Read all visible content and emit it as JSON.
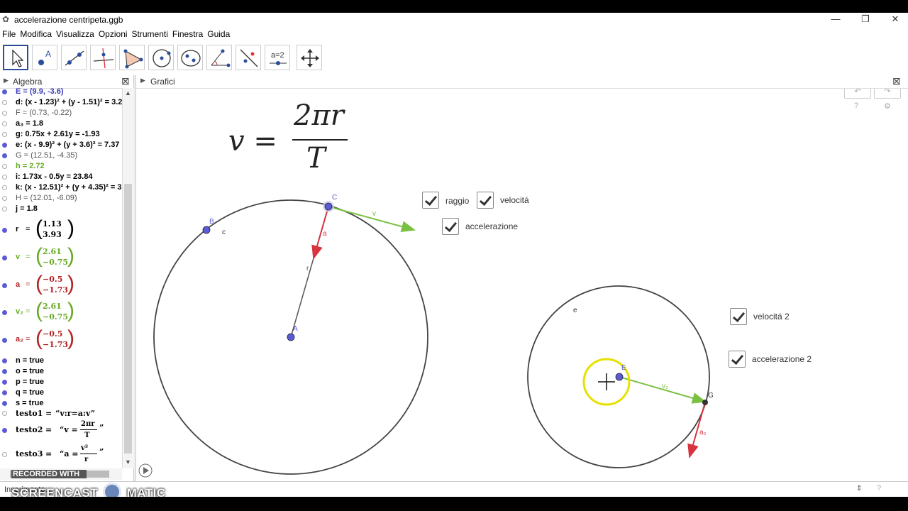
{
  "window": {
    "title": "accelerazione centripeta.ggb"
  },
  "menu": [
    "File",
    "Modifica",
    "Visualizza",
    "Opzioni",
    "Strumenti",
    "Finestra",
    "Guida"
  ],
  "tools": [
    "move-tool",
    "point-tool",
    "line-tool",
    "perpendicular-tool",
    "polygon-tool",
    "circle-tool",
    "conic-tool",
    "angle-tool",
    "reflect-tool",
    "slider-tool",
    "move-view-tool"
  ],
  "slider_tool_label": "a=2",
  "panels": {
    "algebra": "Algebra",
    "graphics": "Grafici"
  },
  "algebra": {
    "rows": [
      {
        "label": "E = (9.9, -3.6)",
        "color": "blue",
        "visible": true
      },
      {
        "label": "d: (x - 1.23)² + (y - 1.51)² = 3.2",
        "color": "black",
        "visible": false
      },
      {
        "label": "F = (0.73, -0.22)",
        "color": "gray",
        "visible": false
      },
      {
        "label": "a₃ = 1.8",
        "color": "black",
        "visible": false
      },
      {
        "label": "g: 0.75x + 2.61y = -1.93",
        "color": "black",
        "visible": false
      },
      {
        "label": "e: (x - 9.9)² + (y + 3.6)² = 7.37",
        "color": "black",
        "visible": true
      },
      {
        "label": "G = (12.51, -4.35)",
        "color": "gray",
        "visible": true
      },
      {
        "label": "h = 2.72",
        "color": "green",
        "visible": false
      },
      {
        "label": "i: 1.73x - 0.5y = 23.84",
        "color": "black",
        "visible": false
      },
      {
        "label": "k: (x - 12.51)² + (y + 4.35)² = 3",
        "color": "black",
        "visible": false
      },
      {
        "label": "H = (12.01, -6.09)",
        "color": "gray",
        "visible": false
      },
      {
        "label": "j = 1.8",
        "color": "black",
        "visible": false
      }
    ],
    "vectors": [
      {
        "name": "r",
        "top": "1.13",
        "bottom": "3.93",
        "color": "black"
      },
      {
        "name": "v",
        "top": "2.61",
        "bottom": "−0.75",
        "color": "green"
      },
      {
        "name": "a",
        "top": "−0.5",
        "bottom": "−1.73",
        "color": "red"
      },
      {
        "name": "v₂",
        "top": "2.61",
        "bottom": "−0.75",
        "color": "green"
      },
      {
        "name": "a₂",
        "top": "−0.5",
        "bottom": "−1.73",
        "color": "red"
      }
    ],
    "booleans": [
      "n = true",
      "o = true",
      "p = true",
      "q = true",
      "s = true"
    ],
    "texts": [
      {
        "name": "testo1",
        "value": "“v:r=a:v”"
      },
      {
        "name": "testo2",
        "prefix": "“v =",
        "num": "2πr",
        "den": "T",
        "suffix": "”"
      },
      {
        "name": "testo3",
        "prefix": "“a =",
        "num": "v²",
        "den": "r",
        "suffix": "”"
      }
    ]
  },
  "graphics": {
    "formula": {
      "lhs": "v =",
      "num": "2πr",
      "den": "T"
    },
    "checkboxes": [
      {
        "label": "raggio",
        "checked": true
      },
      {
        "label": "velocitá",
        "checked": true
      },
      {
        "label": "accelerazione",
        "checked": true
      },
      {
        "label": "velocitá 2",
        "checked": true
      },
      {
        "label": "accelerazione 2",
        "checked": true
      }
    ],
    "point_labels": {
      "A": "A",
      "B": "B",
      "C": "C",
      "E": "E",
      "G": "G",
      "c": "c",
      "e": "e"
    },
    "vector_labels": {
      "v": "v",
      "a": "a",
      "r": "r",
      "v2": "v₂",
      "a2": "a₂"
    }
  },
  "input_bar": {
    "label": "Inserimento:"
  },
  "watermark": {
    "recorded": "RECORDED WITH",
    "brand_left": "SCREENCAST",
    "brand_right": "MATIC"
  },
  "colors": {
    "point": "#5b5bd6",
    "velocity": "#7ac142",
    "acceleration": "#d9333f",
    "selection": "#e8e000"
  }
}
